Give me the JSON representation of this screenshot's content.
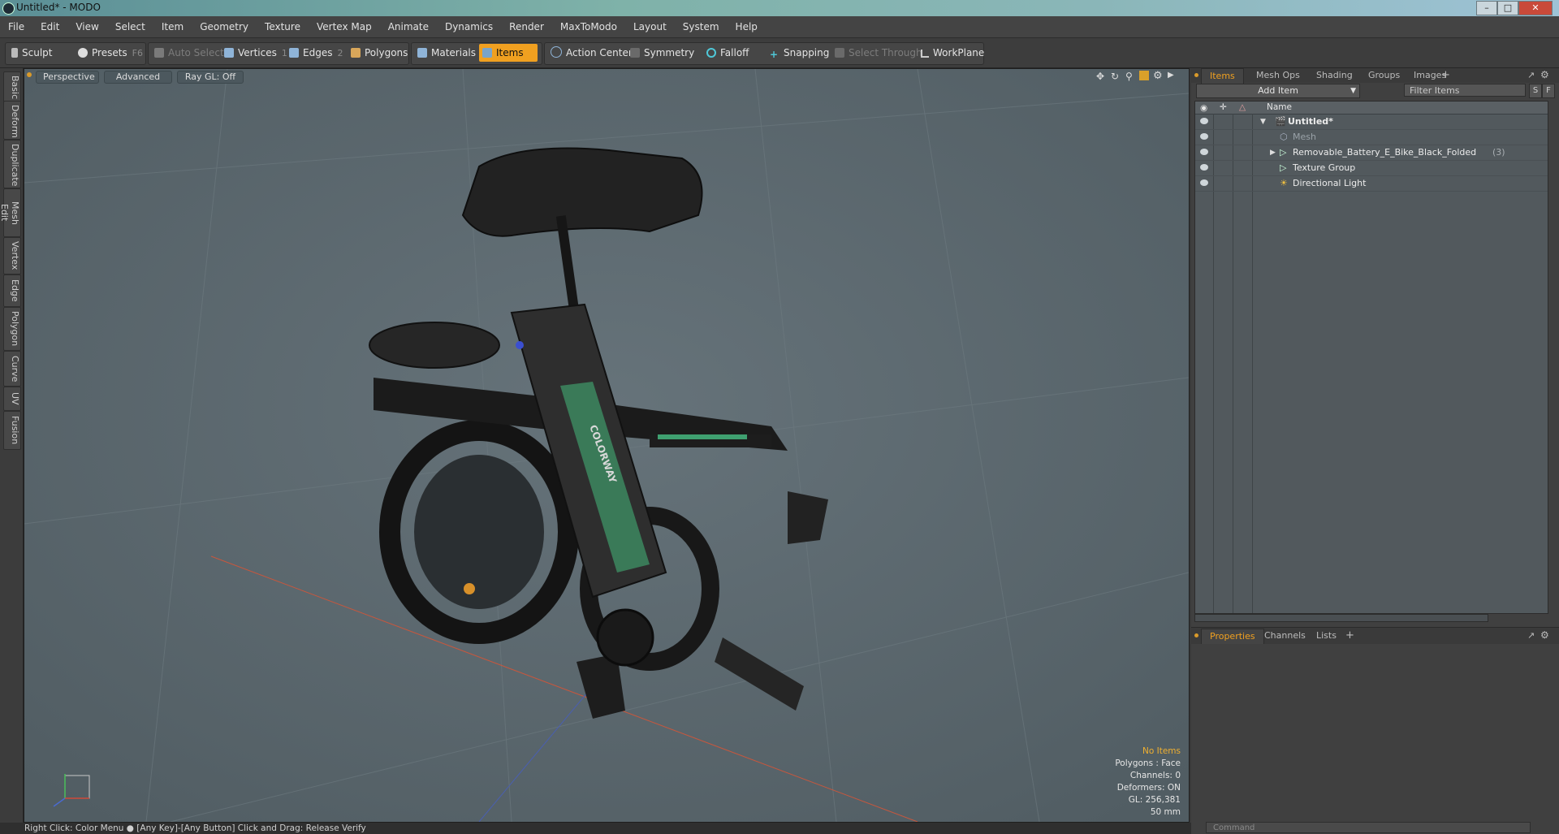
{
  "window": {
    "title": "Untitled* - MODO"
  },
  "menu": [
    "File",
    "Edit",
    "View",
    "Select",
    "Item",
    "Geometry",
    "Texture",
    "Vertex Map",
    "Animate",
    "Dynamics",
    "Render",
    "MaxToModo",
    "Layout",
    "System",
    "Help"
  ],
  "toolbar": {
    "sculpt": "Sculpt",
    "presets": "Presets",
    "presets_shortcut": "F6",
    "auto_select": "Auto Select",
    "vertices": "Vertices",
    "vertices_shortcut": "1",
    "edges": "Edges",
    "edges_shortcut": "2",
    "polygons": "Polygons",
    "materials": "Materials",
    "items": "Items",
    "action_center": "Action Center",
    "symmetry": "Symmetry",
    "falloff": "Falloff",
    "snapping": "Snapping",
    "select_through": "Select Through",
    "workplane": "WorkPlane"
  },
  "left_tabs": [
    "Basic",
    "Deform",
    "Duplicate",
    "Mesh Edit",
    "Vertex",
    "Edge",
    "Polygon",
    "Curve",
    "UV",
    "Fusion"
  ],
  "viewport": {
    "view_mode": "Perspective",
    "shading": "Advanced",
    "raygl": "Ray GL: Off",
    "stats": {
      "selection": "No Items",
      "polygons": "Polygons : Face",
      "channels": "Channels: 0",
      "deformers": "Deformers: ON",
      "gl": "GL: 256,381",
      "focal": "50 mm"
    },
    "model_branding": "COLORWAY"
  },
  "status": {
    "hint": "Right Click: Color Menu ● [Any Key]-[Any Button] Click and Drag: Release Verify"
  },
  "right_panel": {
    "tabs": [
      "Items",
      "Mesh Ops",
      "Shading",
      "Groups",
      "Images"
    ],
    "add_item": "Add Item",
    "filter_placeholder": "Filter Items",
    "s_btn": "S",
    "f_btn": "F",
    "column_name": "Name",
    "items": [
      {
        "name": "Untitled*",
        "bold": true,
        "count": ""
      },
      {
        "name": "Mesh",
        "dim": true,
        "count": ""
      },
      {
        "name": "Removable_Battery_E_Bike_Black_Folded",
        "count": "(3)"
      },
      {
        "name": "Texture Group",
        "count": ""
      },
      {
        "name": "Directional Light",
        "count": ""
      }
    ],
    "bottom_tabs": [
      "Properties",
      "Channels",
      "Lists"
    ],
    "command_placeholder": "Command"
  }
}
